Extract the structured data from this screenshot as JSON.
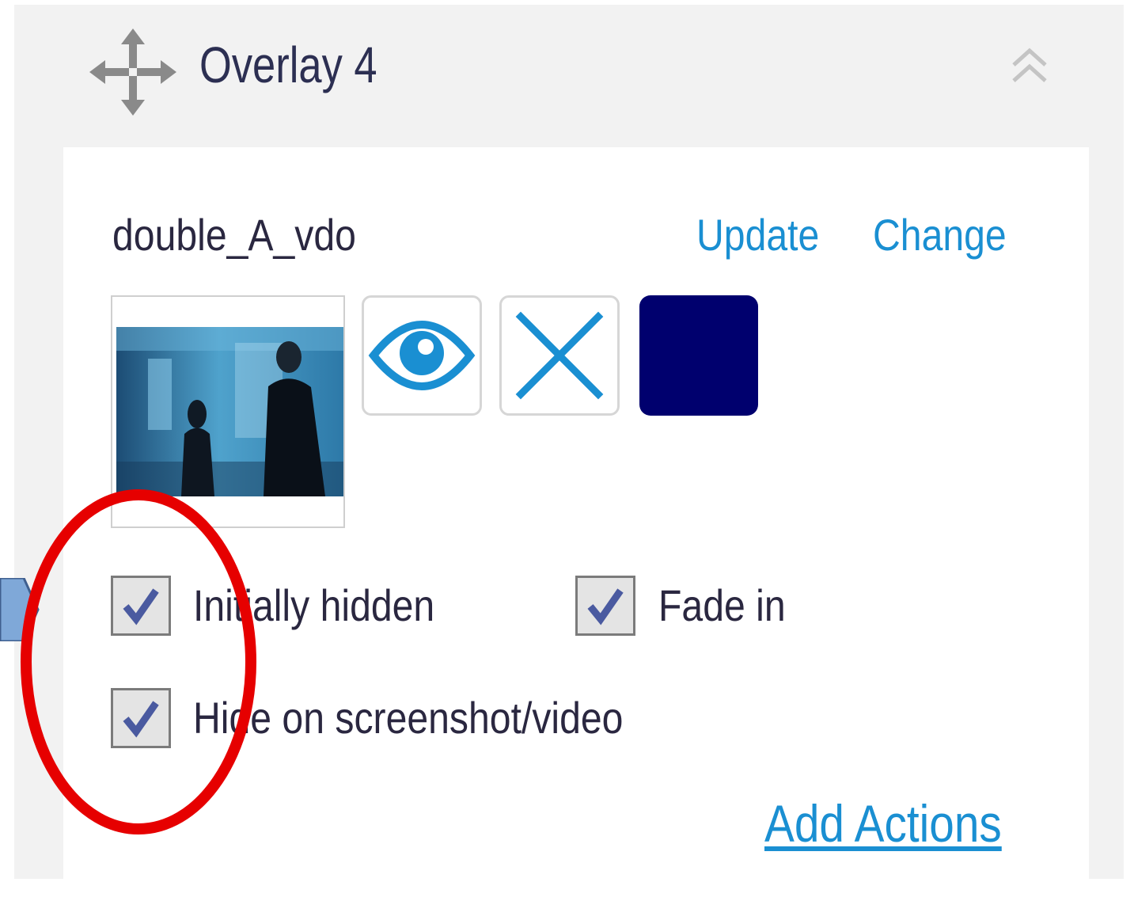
{
  "overlay": {
    "title": "Overlay 4",
    "move_icon": "move-arrows-icon",
    "collapse_icon": "double-chevron-up-icon"
  },
  "media": {
    "file_name": "double_A_vdo",
    "update_label": "Update",
    "change_label": "Change",
    "thumbnail": "video-thumbnail",
    "buttons": {
      "visibility_icon": "eye-icon",
      "remove_icon": "close-icon"
    },
    "overlay_color": "#00006e"
  },
  "options": {
    "initially_hidden": {
      "label": "Initially hidden",
      "checked": true
    },
    "fade_in": {
      "label": "Fade in",
      "checked": true
    },
    "hide_on_capture": {
      "label": "Hide on screenshot/video",
      "checked": true
    }
  },
  "actions": {
    "add_label": "Add Actions"
  },
  "colors": {
    "link": "#1a8fd2",
    "icon_blue": "#1a8fd2",
    "highlight": "#e60000"
  }
}
